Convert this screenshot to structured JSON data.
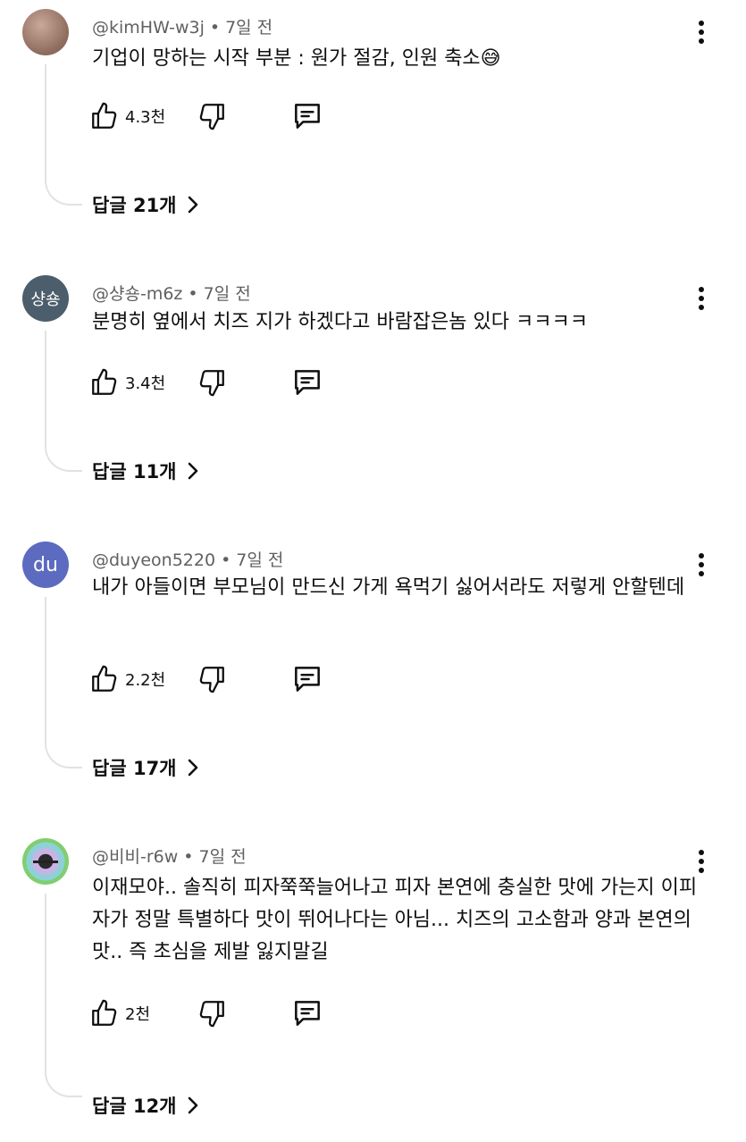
{
  "comments": [
    {
      "author": "@kimHW-w3j",
      "time": "7일 전",
      "text": "기업이 망하는 시작 부분 : 원가 절감, 인원 축소😅",
      "likes": "4.3천",
      "replies_label": "답글 21개",
      "avatar_text": "",
      "avatar_color": "#9b7b6e"
    },
    {
      "author": "@샹숑-m6z",
      "time": "7일 전",
      "text": "분명히 옆에서 치즈 지가 하겠다고 바람잡은놈 있다 ㅋㅋㅋㅋ",
      "likes": "3.4천",
      "replies_label": "답글 11개",
      "avatar_text": "샹숑",
      "avatar_color": "#4c5e6b"
    },
    {
      "author": "@duyeon5220",
      "time": "7일 전",
      "text": "내가 아들이면 부모님이 만드신 가게 욕먹기 싫어서라도 저렇게 안할텐데",
      "likes": "2.2천",
      "replies_label": "답글 17개",
      "avatar_text": "du",
      "avatar_color": "#5c6bc0"
    },
    {
      "author": "@비비-r6w",
      "time": "7일 전",
      "text": "이재모야.. 솔직히 피자쭉쭉늘어나고 피자 본연에 충실한 맛에 가는지 이피자가 정말 특별하다 맛이 뛰어나다는 아님... 치즈의 고소함과 양과 본연의맛.. 즉 초심을 제발 잃지말길",
      "likes": "2천",
      "replies_label": "답글 12개",
      "avatar_text": "",
      "avatar_color": "#6fb56a"
    }
  ],
  "icons": {
    "like": "thumbs-up-icon",
    "dislike": "thumbs-down-icon",
    "reply": "comment-icon",
    "more": "more-vertical-icon",
    "chevron": "chevron-right-icon"
  }
}
